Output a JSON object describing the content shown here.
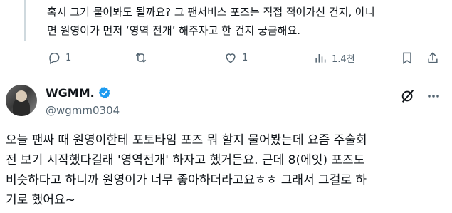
{
  "previous_reply": {
    "text": "혹시 그거 물어봐도 될까요? 그 팬서비스 포즈는 직접 적어가신 건지, 아니\n면 원영이가 먼저 ‘영역 전개’ 해주자고 한 건지 궁금해요.",
    "replies": "1",
    "views": "1.4천"
  },
  "post": {
    "display_name": "WGMM.",
    "handle": "@wgmm0304",
    "text": "오늘 팬싸 때 원영이한테 포토타임 포즈 뭐 할지 물어봤는데 요즘 주술회\n전 보기 시작했다길래 '영역전개' 하자고 했거든요. 근데 8(에잇) 포즈도\n비슷하다고 하니까 원영이가 너무 좋아하더라고요ㅎㅎ 그래서 그걸로 하\n기로 했어요~"
  },
  "colors": {
    "text": "#0f1419",
    "secondary": "#536471",
    "verified": "#1d9bf0",
    "line": "#cfd9de"
  },
  "icons": [
    "reply-icon",
    "retweet-icon",
    "like-icon",
    "views-icon",
    "bookmark-icon",
    "share-icon",
    "verified-badge-icon",
    "grok-icon",
    "more-icon"
  ]
}
